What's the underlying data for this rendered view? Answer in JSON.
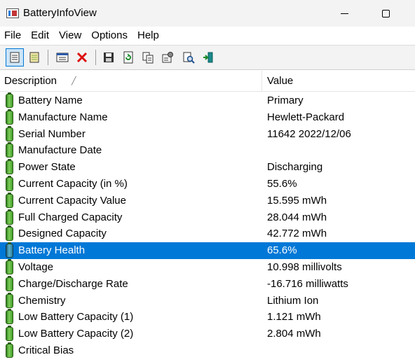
{
  "window": {
    "title": "BatteryInfoView"
  },
  "menu": [
    "File",
    "Edit",
    "View",
    "Options",
    "Help"
  ],
  "toolbar": [
    {
      "name": "properties-icon"
    },
    {
      "name": "report-icon"
    },
    {
      "name": "html-report-icon"
    },
    {
      "name": "delete-icon"
    },
    {
      "name": "save-icon"
    },
    {
      "name": "refresh-icon"
    },
    {
      "name": "copy-icon"
    },
    {
      "name": "options-icon"
    },
    {
      "name": "find-icon"
    },
    {
      "name": "exit-icon"
    }
  ],
  "columns": {
    "description": "Description",
    "value": "Value"
  },
  "rows": [
    {
      "description": "Battery Name",
      "value": "Primary"
    },
    {
      "description": "Manufacture Name",
      "value": "Hewlett-Packard"
    },
    {
      "description": "Serial Number",
      "value": "11642 2022/12/06"
    },
    {
      "description": "Manufacture Date",
      "value": ""
    },
    {
      "description": "Power State",
      "value": "Discharging"
    },
    {
      "description": "Current Capacity (in %)",
      "value": "55.6%"
    },
    {
      "description": "Current Capacity Value",
      "value": "15.595 mWh"
    },
    {
      "description": "Full Charged Capacity",
      "value": "28.044 mWh"
    },
    {
      "description": "Designed Capacity",
      "value": "42.772 mWh"
    },
    {
      "description": "Battery Health",
      "value": "65.6%",
      "selected": true
    },
    {
      "description": "Voltage",
      "value": "10.998 millivolts"
    },
    {
      "description": "Charge/Discharge Rate",
      "value": "-16.716 milliwatts"
    },
    {
      "description": "Chemistry",
      "value": "Lithium Ion"
    },
    {
      "description": "Low Battery Capacity (1)",
      "value": "1.121 mWh"
    },
    {
      "description": "Low Battery Capacity (2)",
      "value": "2.804 mWh"
    },
    {
      "description": "Critical Bias",
      "value": ""
    }
  ]
}
